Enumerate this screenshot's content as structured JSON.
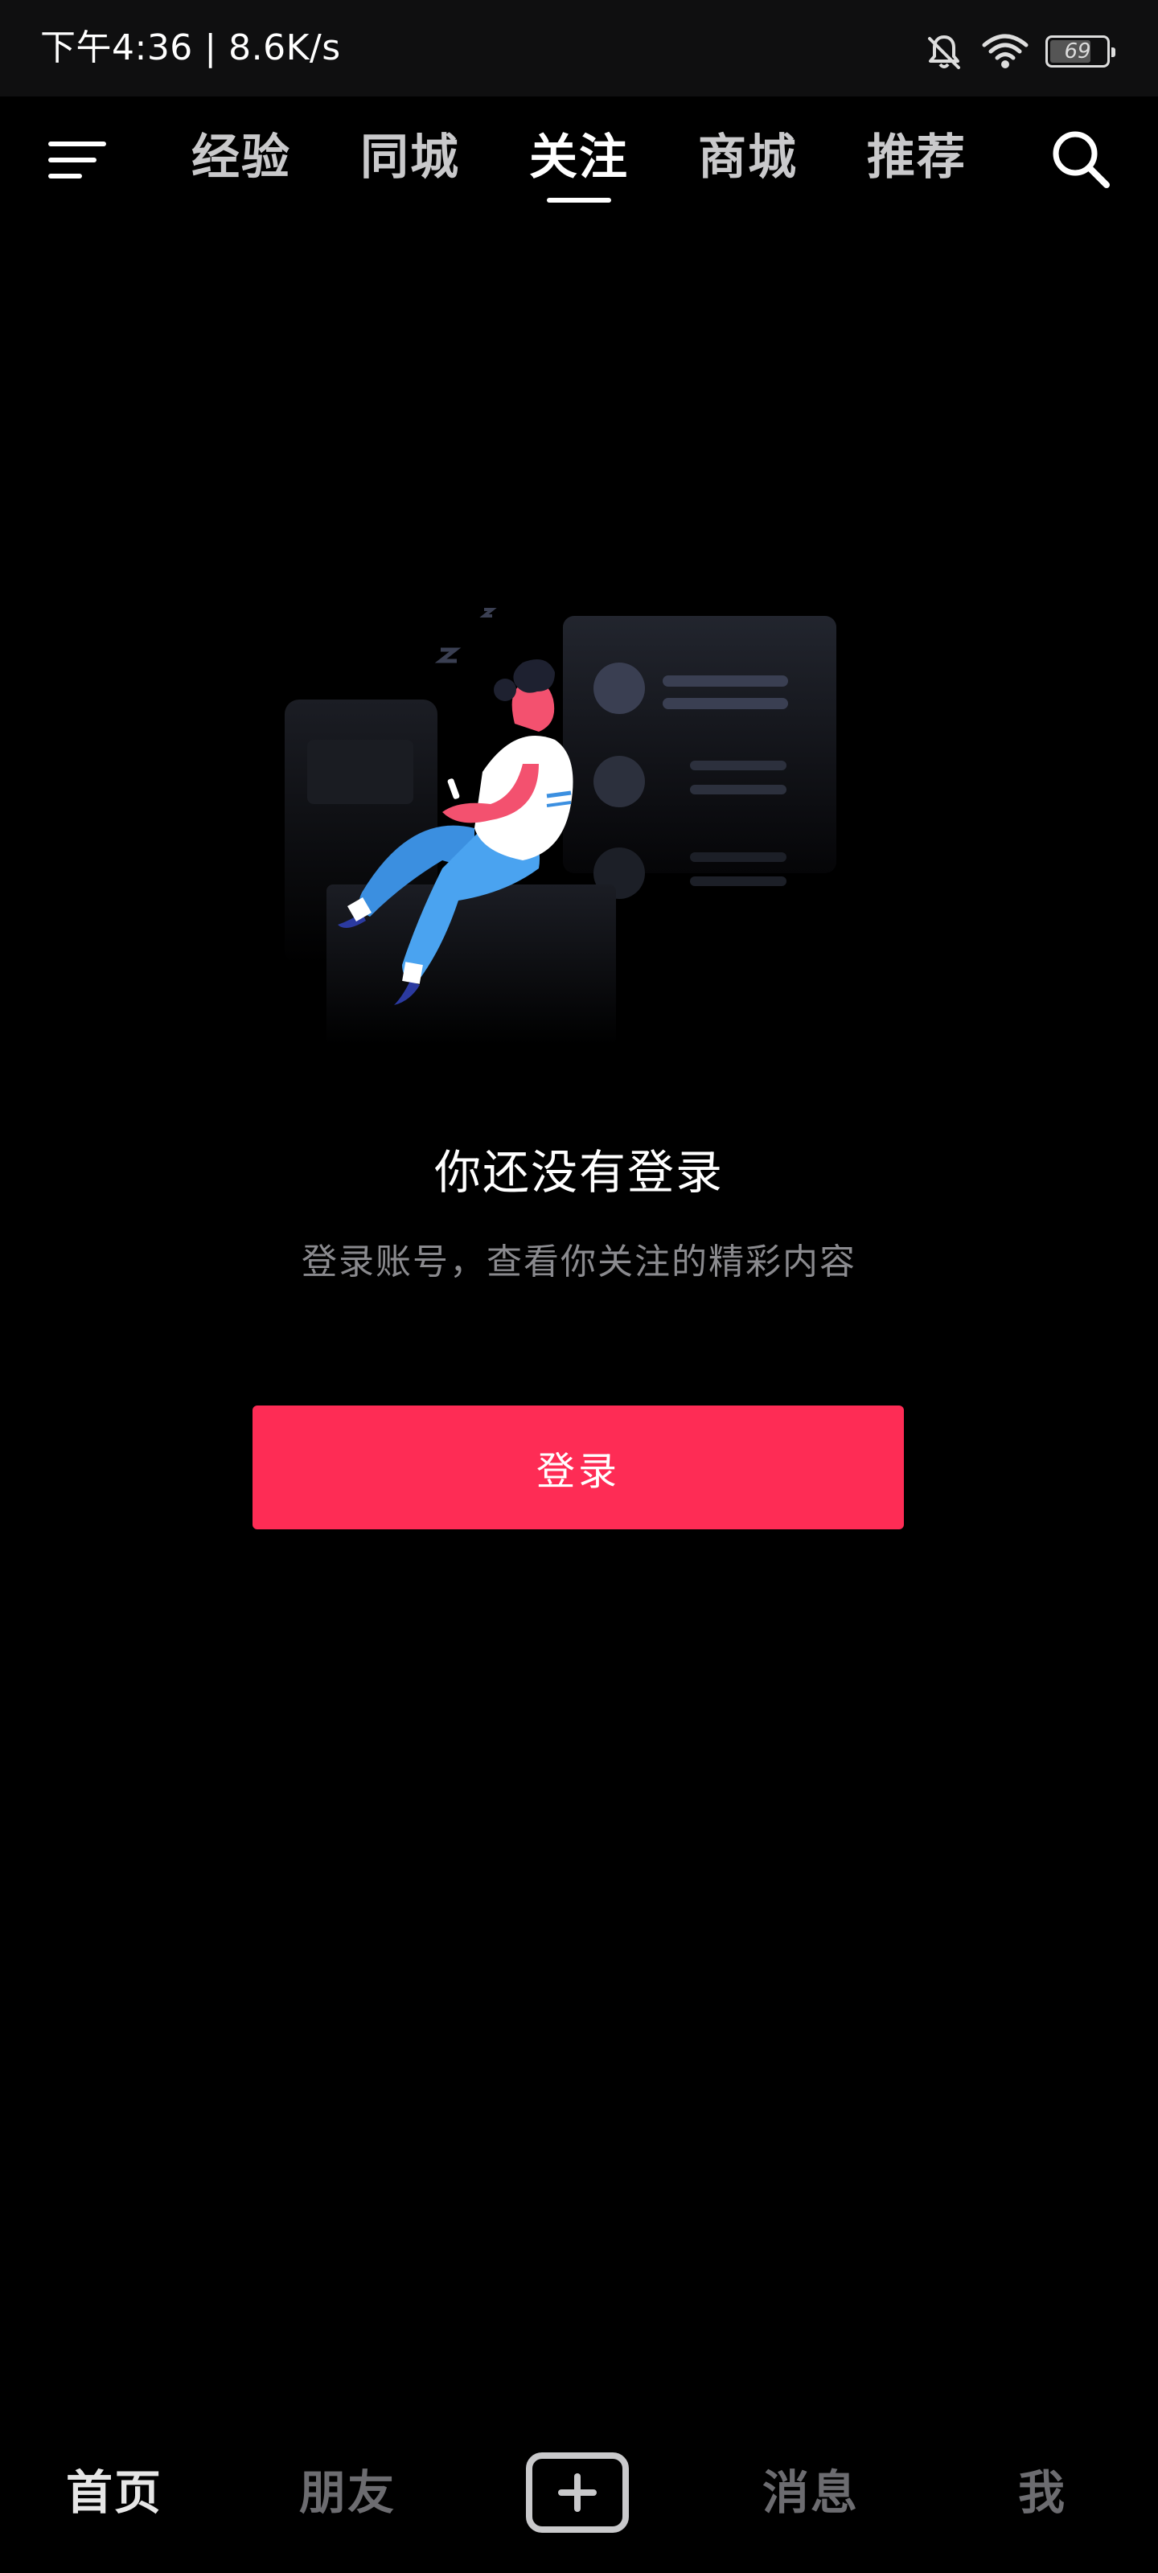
{
  "status_bar": {
    "time_speed": "下午4:36 | 8.6K/s",
    "battery": "69",
    "icons": [
      "bell-muted-icon",
      "wifi-icon",
      "battery-icon"
    ]
  },
  "top_nav": {
    "tabs": [
      {
        "label": "经验"
      },
      {
        "label": "同城"
      },
      {
        "label": "关注"
      },
      {
        "label": "商城"
      },
      {
        "label": "推荐"
      }
    ],
    "active_tab": "关注",
    "icons": [
      "menu-icon",
      "search-icon"
    ]
  },
  "empty_state": {
    "title": "你还没有登录",
    "subtitle": "登录账号，查看你关注的精彩内容",
    "button_label": "登录"
  },
  "bottom_nav": {
    "items": [
      {
        "label": "首页"
      },
      {
        "label": "朋友"
      },
      {
        "label": "消息"
      },
      {
        "label": "我"
      }
    ],
    "active_item": "首页",
    "center_icon": "plus-icon"
  },
  "colors": {
    "background": "#000000",
    "accent": "#fe2c55",
    "tab_inactive": "#c9c9cb",
    "subtitle": "#8a8a8e"
  }
}
